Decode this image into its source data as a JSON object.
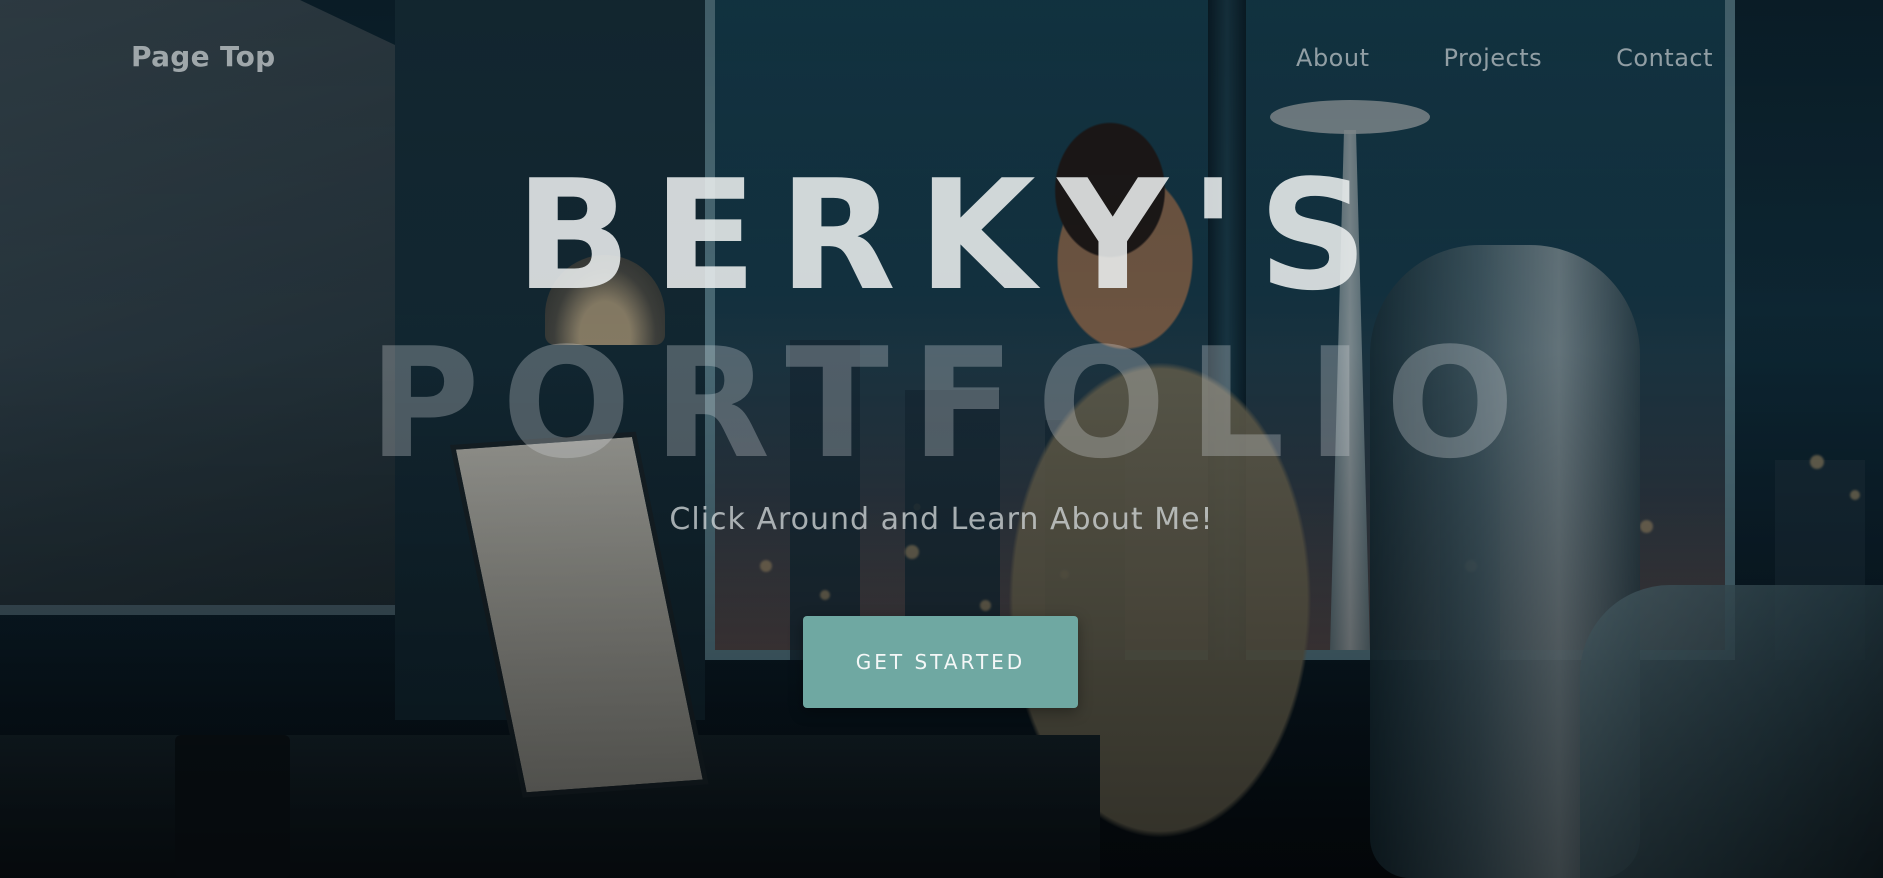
{
  "nav": {
    "brand": "Page Top",
    "links": [
      {
        "label": "About"
      },
      {
        "label": "Projects"
      },
      {
        "label": "Contact"
      }
    ]
  },
  "hero": {
    "title_line1": "BERKY'S",
    "title_line2": "PORTFOLIO",
    "subtitle": "Click Around and Learn About Me!",
    "cta_label": "GET STARTED",
    "background": "illustration of a man typing on a laptop at a desk with a city skyline and space needle at night outside the window"
  },
  "colors": {
    "accent": "#6fa8a2",
    "text_light": "#ebeeee"
  }
}
